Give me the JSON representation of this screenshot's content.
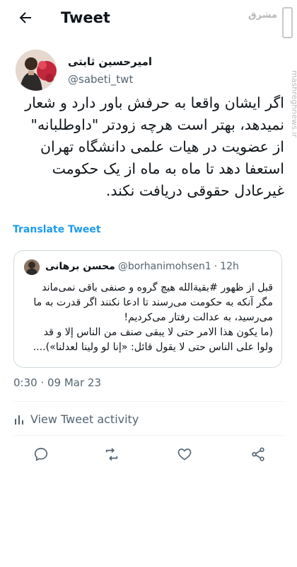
{
  "header": {
    "title": "Tweet"
  },
  "watermark": {
    "text": "مشرق"
  },
  "side_url": "mashreghnews.ir",
  "author": {
    "name": "امیرحسین ثابتی",
    "handle": "@sabeti_twt"
  },
  "tweet": {
    "lines": [
      "اگر ایشان واقعا به حرفش باور دارد و شعار",
      "نمیدهد، بهتر است هرچه زودتر \"داوطلبانه\"",
      "از عضویت در هیات علمی دانشگاه تهران",
      "استعفا دهد تا ماه به ماه از یک حکومت",
      "غیرعادل حقوقی دریافت نکند."
    ],
    "translate_label": "Translate Tweet"
  },
  "quote": {
    "name": "محسن برهانی",
    "handle": "@borhanimohsen1",
    "separator": "·",
    "time": "12h",
    "lines": [
      "قبل از ظهور #بقیة‌الله هیچ گروه و صنفی باقی نمی‌ماند",
      "مگر آنکه به حکومت می‌رسند تا ادعا نکنند اگر قدرت به ما",
      "می‌رسید، به عدالت رفتار می‌کردیم!",
      "(ما یکون هذا الامر حتی لا یبقی صنف من الناس إلا و قد",
      "ولوا علی الناس حتی لا یقول قائل: «إنا لو ولینا لعدلنا»)...."
    ]
  },
  "timestamp": "0:30 · 09 Mar 23",
  "activity_label": "View Tweet activity",
  "colors": {
    "link": "#1d9bf0",
    "muted": "#536471",
    "text": "#0f1419",
    "border": "#cfd9de"
  }
}
